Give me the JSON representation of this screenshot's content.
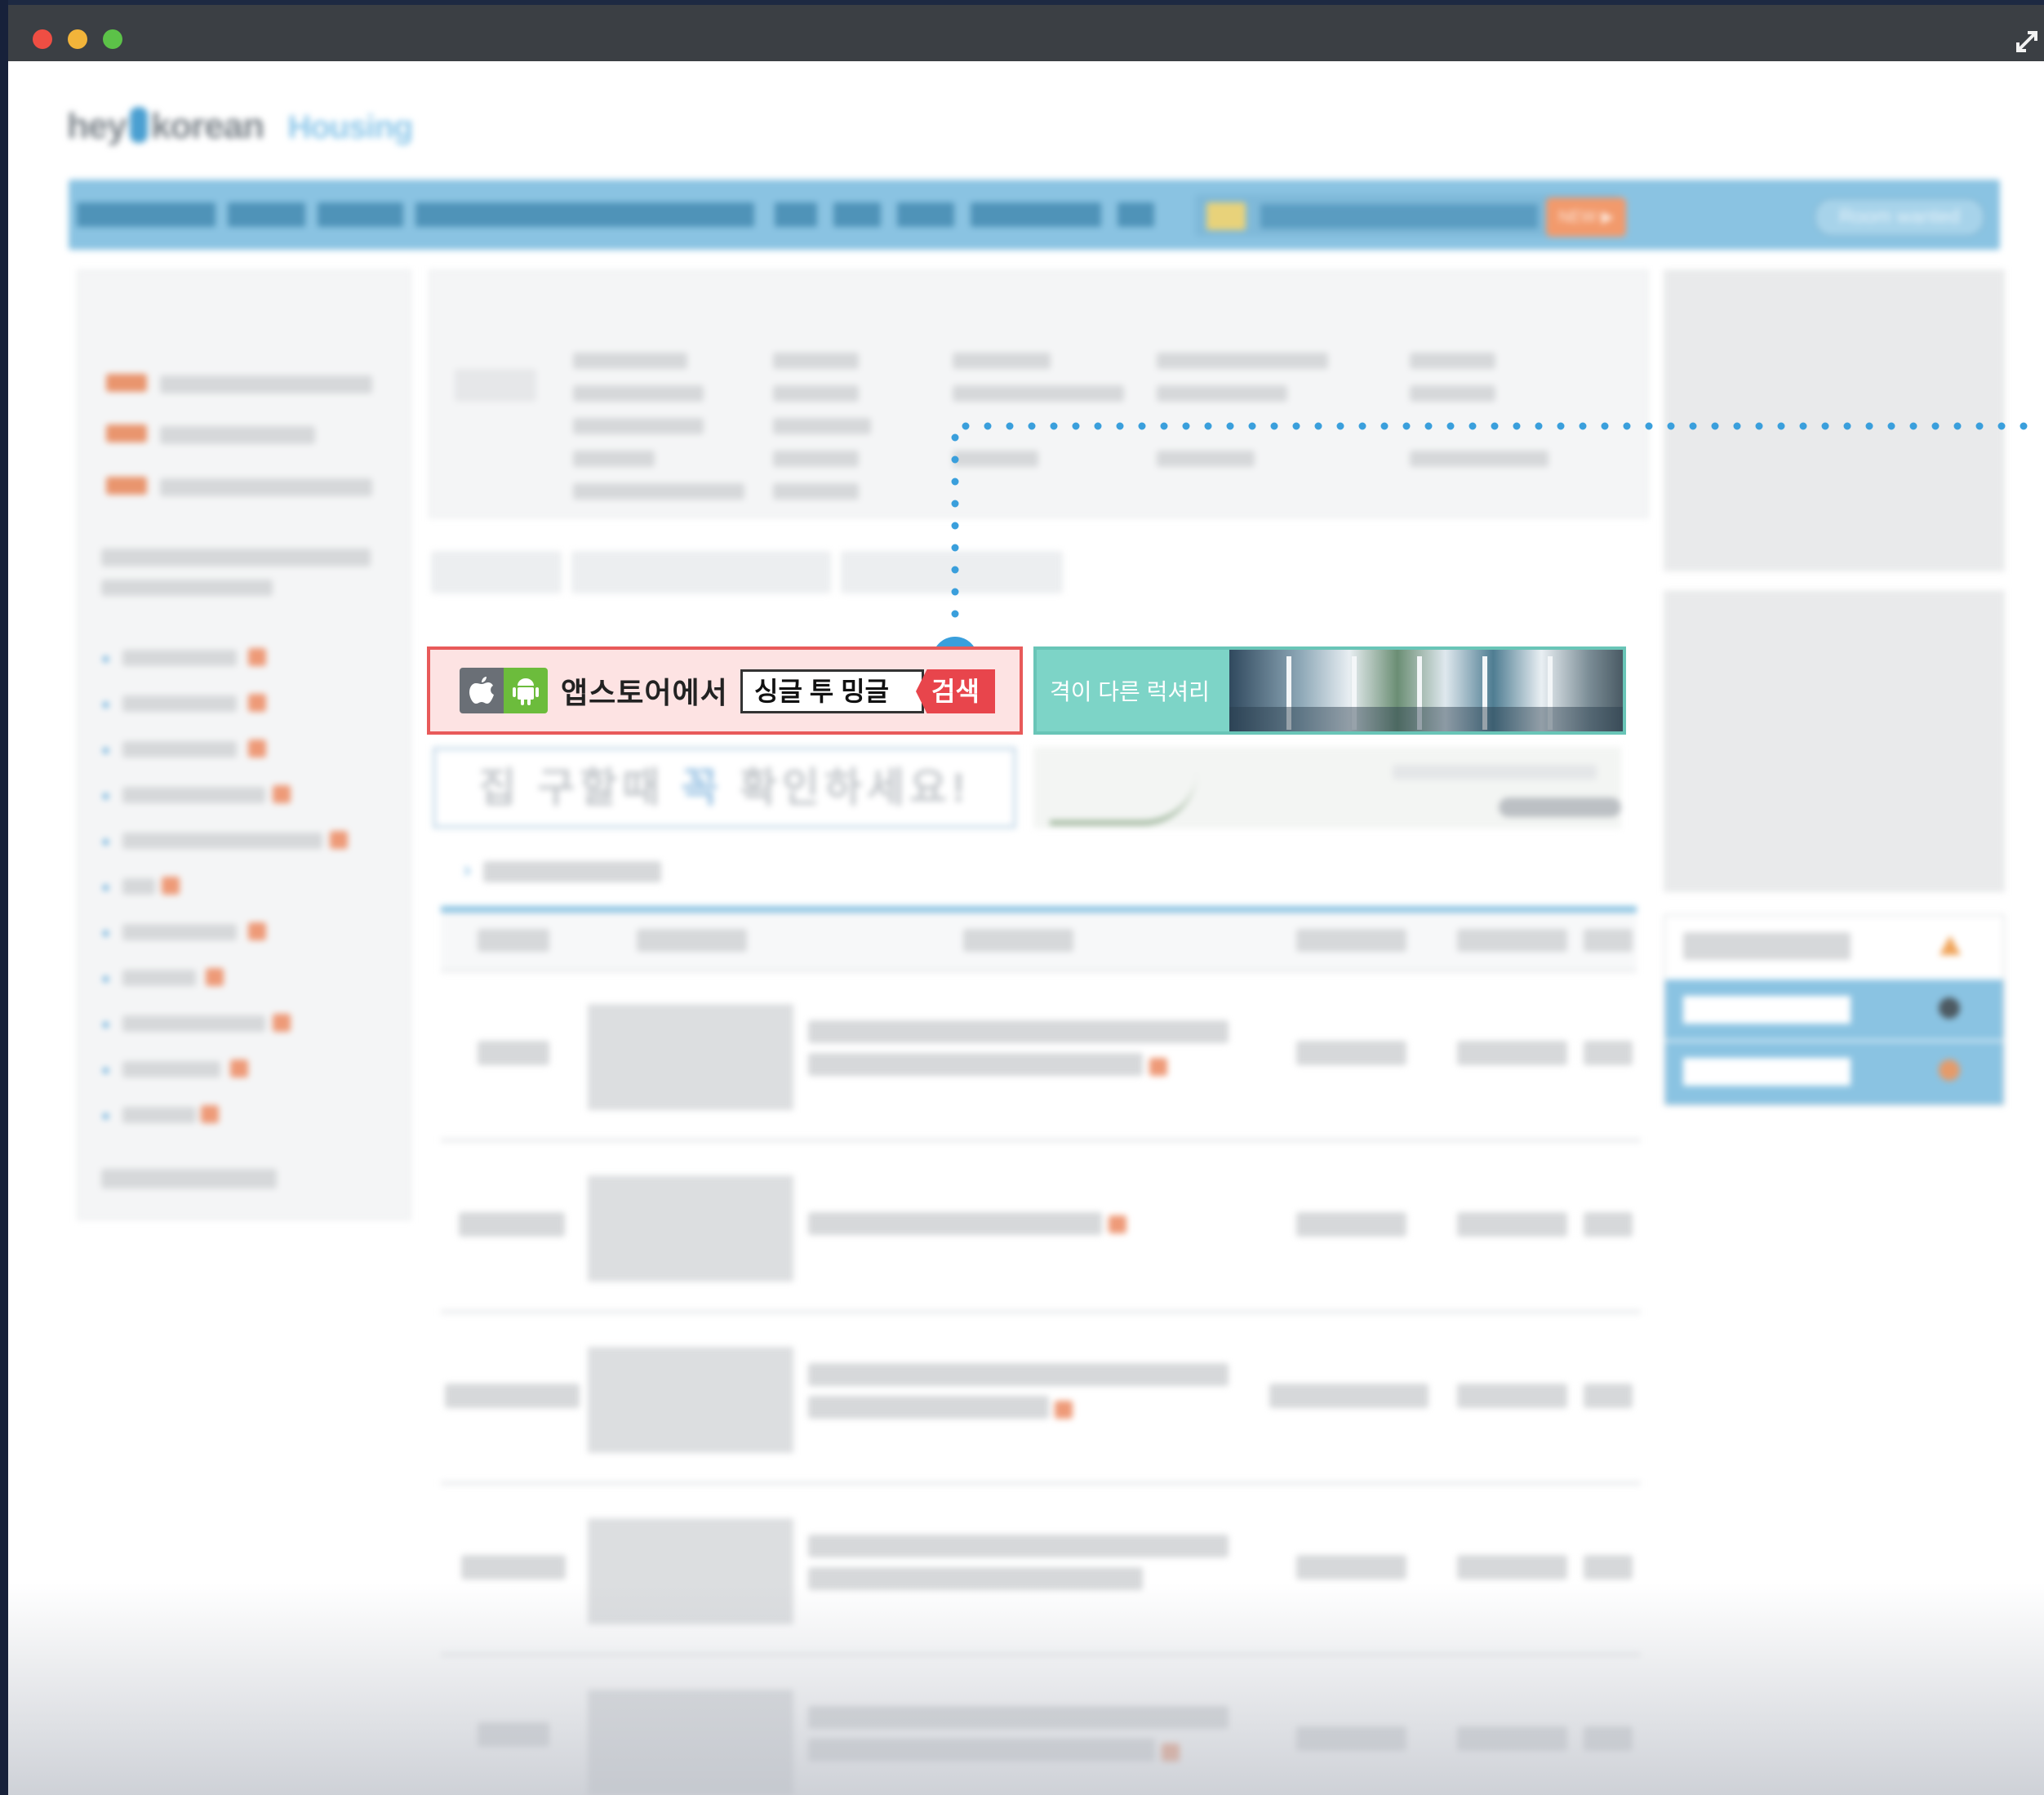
{
  "brand": {
    "logo_part1": "hey",
    "logo_part2": "korean",
    "section": "Housing"
  },
  "nav": {
    "new_label": "NEW ▶",
    "room_wanted": "Room wanted"
  },
  "promo": {
    "store_label": "앱스토어에서",
    "search_keyword": "싱글 투 밍글",
    "search_button": "검색"
  },
  "ad": {
    "luxury_text": "격이 다른 럭셔리"
  },
  "banner": {
    "notice_part1": "집 구할때",
    "notice_highlight": "꼭",
    "notice_part2": "확인하세요!"
  },
  "colors": {
    "accent_blue": "#8ac3e2",
    "promo_red": "#e85a5a",
    "ad_teal": "#7dd4c7",
    "connector_blue": "#3a9fdc"
  },
  "icons": [
    "apple-icon",
    "android-icon",
    "expand-icon",
    "warning-icon"
  ]
}
